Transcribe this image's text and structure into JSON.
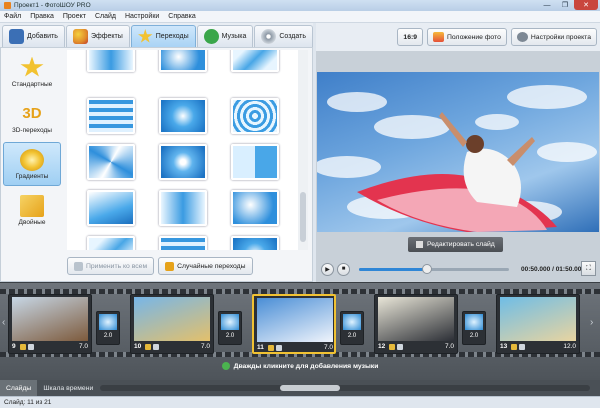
{
  "window": {
    "title": "Проект1 - ФотоШОУ PRO",
    "close_glyph": "✕",
    "min_glyph": "—",
    "max_glyph": "❐"
  },
  "menu": [
    "Файл",
    "Правка",
    "Проект",
    "Слайд",
    "Настройки",
    "Справка"
  ],
  "tabs": [
    {
      "label": "Добавить",
      "icon": "folder-icon",
      "color": "#3b6fb5",
      "active": false
    },
    {
      "label": "Эффекты",
      "icon": "palette-icon",
      "color": "#e08a2a",
      "active": false
    },
    {
      "label": "Переходы",
      "icon": "star-icon",
      "color": "#f2c230",
      "active": true
    },
    {
      "label": "Музыка",
      "icon": "music-note-icon",
      "color": "#3aa64a",
      "active": false
    },
    {
      "label": "Создать",
      "icon": "disc-icon",
      "color": "#8a96a3",
      "active": false
    }
  ],
  "toolbar_right": {
    "aspect_label": "16:9",
    "photo_position_label": "Положение фото",
    "project_settings_label": "Настройки проекта"
  },
  "categories": [
    {
      "label": "Стандартные",
      "icon": "star-icon",
      "active": false
    },
    {
      "label": "3D-переходы",
      "icon": "3d-icon",
      "active": false
    },
    {
      "label": "Градиенты",
      "icon": "gradient-icon",
      "active": true
    },
    {
      "label": "Двойные",
      "icon": "double-icon",
      "active": false
    }
  ],
  "cat_3d_glyph": "3D",
  "transitions_count": 16,
  "actions": {
    "apply_all_label": "Применить ко всем",
    "random_label": "Случайные переходы"
  },
  "preview": {
    "edit_slide_label": "Редактировать слайд",
    "timecode": "00:50.000 / 01:50.000",
    "progress": 0.45,
    "play_glyph": "▶",
    "stop_glyph": "■",
    "fullscreen_glyph": "⛶"
  },
  "slides": [
    {
      "num": "9",
      "duration": "7.0",
      "colors": [
        "#c7d7e6",
        "#7d5a3c"
      ],
      "selected": false,
      "trans": "2.0"
    },
    {
      "num": "10",
      "duration": "7.0",
      "colors": [
        "#77b6e8",
        "#e3c06b"
      ],
      "selected": false,
      "trans": "2.0"
    },
    {
      "num": "11",
      "duration": "7.0",
      "colors": [
        "#4a8ed6",
        "#f0f4fb"
      ],
      "selected": true,
      "trans": "2.0"
    },
    {
      "num": "12",
      "duration": "7.0",
      "colors": [
        "#e9e6d8",
        "#2c2f36"
      ],
      "selected": false,
      "trans": "2.0"
    },
    {
      "num": "13",
      "duration": "12.0",
      "colors": [
        "#6fbde6",
        "#e8d4a0"
      ],
      "selected": false,
      "trans": ""
    }
  ],
  "timeline": {
    "music_hint": "Дважды кликните для добавления музыки",
    "left_arrow": "‹",
    "right_arrow": "›"
  },
  "bottom_tabs": [
    {
      "label": "Слайды",
      "active": true
    },
    {
      "label": "Шкала времени",
      "active": false
    }
  ],
  "status": {
    "text": "Слайд: 11 из 21"
  }
}
